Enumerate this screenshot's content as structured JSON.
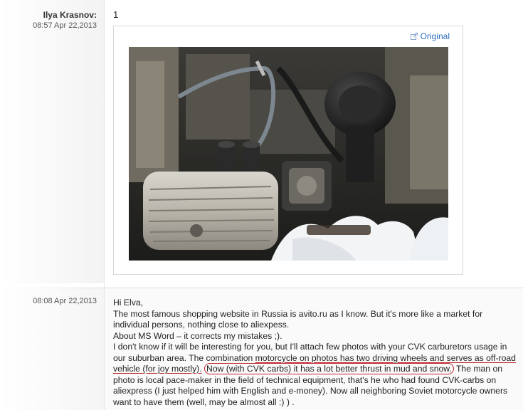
{
  "post1": {
    "author": "Ilya Krasnov:",
    "timestamp": "08:57 Apr 22,2013",
    "text": "1",
    "original_link": "Original",
    "image_icon": "external-link-icon"
  },
  "post2": {
    "timestamp": "08:08 Apr 22,2013",
    "greeting": "Hi Elva,",
    "line1": "The most famous shopping website in Russia is avito.ru as I know. But it's more like a market for individual persons, nothing close to aliexpess.",
    "line2": "About MS Word – it corrects my mistakes ;).",
    "p3_a": "I don't know if it will be interesting for you, but I'll attach few photos with your CVK carburetors usage in our suburban area. The combination ",
    "p3_b": "motorcycle on photos has two driving wheels and serves as off-road vehicle (for joy mostly).",
    "p3_c": " ",
    "p3_d": "Now (with CVK carbs) it has a lot better thrust in mud and snow.",
    "p3_e": " The man on photo is local pace-maker in the field of technical equipment, that's he who had found CVK-carbs on aliexpress (I just helped him with English and e-money). Now all neighboring Soviet motorcycle owners want to have them (well, may be almost all :) ) ."
  },
  "colors": {
    "link": "#2a6ebb",
    "annotation_red": "#c0262c"
  }
}
